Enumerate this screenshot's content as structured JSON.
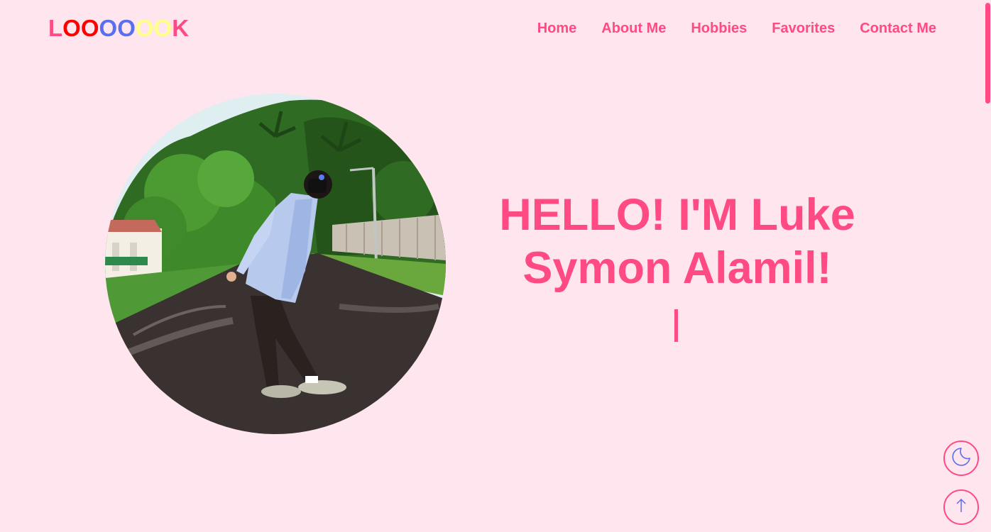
{
  "logo": {
    "letters": [
      {
        "char": "L",
        "color": "#ff4a84"
      },
      {
        "char": "O",
        "color": "#ff0000"
      },
      {
        "char": "O",
        "color": "#ff0000"
      },
      {
        "char": "O",
        "color": "#5a6ff0"
      },
      {
        "char": "O",
        "color": "#5a6ff0"
      },
      {
        "char": "O",
        "color": "#ffff8a"
      },
      {
        "char": "O",
        "color": "#ffff8a"
      },
      {
        "char": "K",
        "color": "#ff4a84"
      }
    ]
  },
  "nav": {
    "items": [
      {
        "label": "Home"
      },
      {
        "label": "About Me"
      },
      {
        "label": "Hobbies"
      },
      {
        "label": "Favorites"
      },
      {
        "label": "Contact Me"
      }
    ]
  },
  "hero": {
    "title_line1": "HELLO! I'M Luke",
    "title_line2": "Symon Alamil!",
    "typing_cursor": "|"
  },
  "buttons": {
    "theme_icon": "moon-icon",
    "top_icon": "arrow-up-icon"
  },
  "colors": {
    "accent": "#ff4a84",
    "background": "#ffe6ee",
    "icon": "#5a6ff0"
  }
}
